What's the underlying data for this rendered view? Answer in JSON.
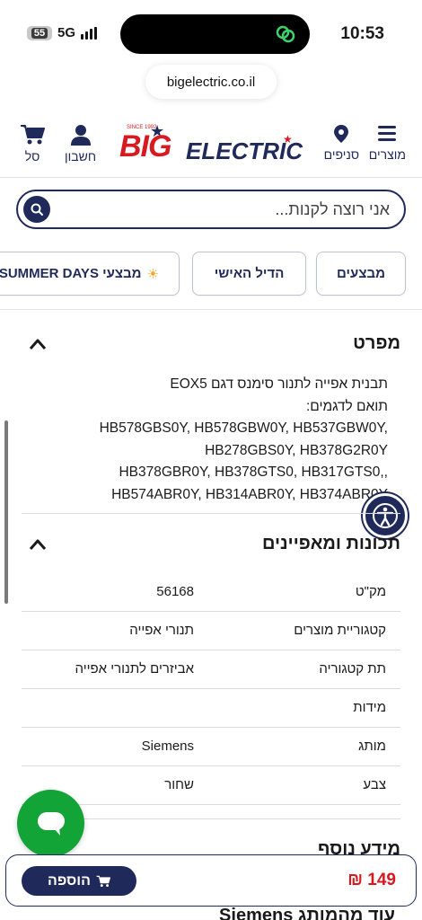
{
  "status_bar": {
    "battery": "55",
    "network": "5G",
    "time": "10:53"
  },
  "browser": {
    "url": "bigelectric.co.il"
  },
  "header": {
    "menu_label": "מוצרים",
    "stores_label": "סניפים",
    "account_label": "חשבון",
    "cart_label": "סל",
    "logo": {
      "big": "BIG",
      "electric": "ELECTRIC",
      "since": "SINCE 1992"
    }
  },
  "search": {
    "placeholder": "אני רוצה לקנות..."
  },
  "chips": [
    {
      "label": "מבצעים"
    },
    {
      "label": "הדיל האישי"
    },
    {
      "label": "מבצעי SUMMER DAYS",
      "icon": "sun-icon"
    }
  ],
  "description_section": {
    "title": "מפרט",
    "lines": [
      "תבנית אפייה לתנור סימנס דגם EOX5",
      "תואם לדגמים:",
      "HB578GBS0Y, HB578GBW0Y, HB537GBW0Y,",
      "HB278GBS0Y, HB378G2R0Y",
      "HB378GBR0Y, HB378GTS0, HB317GTS0,,",
      "HB574ABR0Y, HB314ABR0Y, HB374ABR0Y"
    ]
  },
  "features_section": {
    "title": "תכונות ומאפיינים",
    "rows": [
      {
        "label": "מק\"ט",
        "value": "56168"
      },
      {
        "label": "קטגוריית מוצרים",
        "value": "תנורי אפייה"
      },
      {
        "label": "תת קטגוריה",
        "value": "אביזרים לתנורי אפייה"
      },
      {
        "label": "מידות",
        "value": ""
      },
      {
        "label": "מותג",
        "value": "Siemens"
      },
      {
        "label": "צבע",
        "value": "שחור"
      }
    ]
  },
  "more_info": {
    "title": "מידע נוסף",
    "peek": "עוד מהמותג Siemens"
  },
  "buy_bar": {
    "price": "149",
    "currency": "₪",
    "add_label": "הוספה"
  },
  "colors": {
    "brand_navy": "#1f2a5a",
    "brand_red": "#d71920",
    "chat_green": "#13a438"
  }
}
